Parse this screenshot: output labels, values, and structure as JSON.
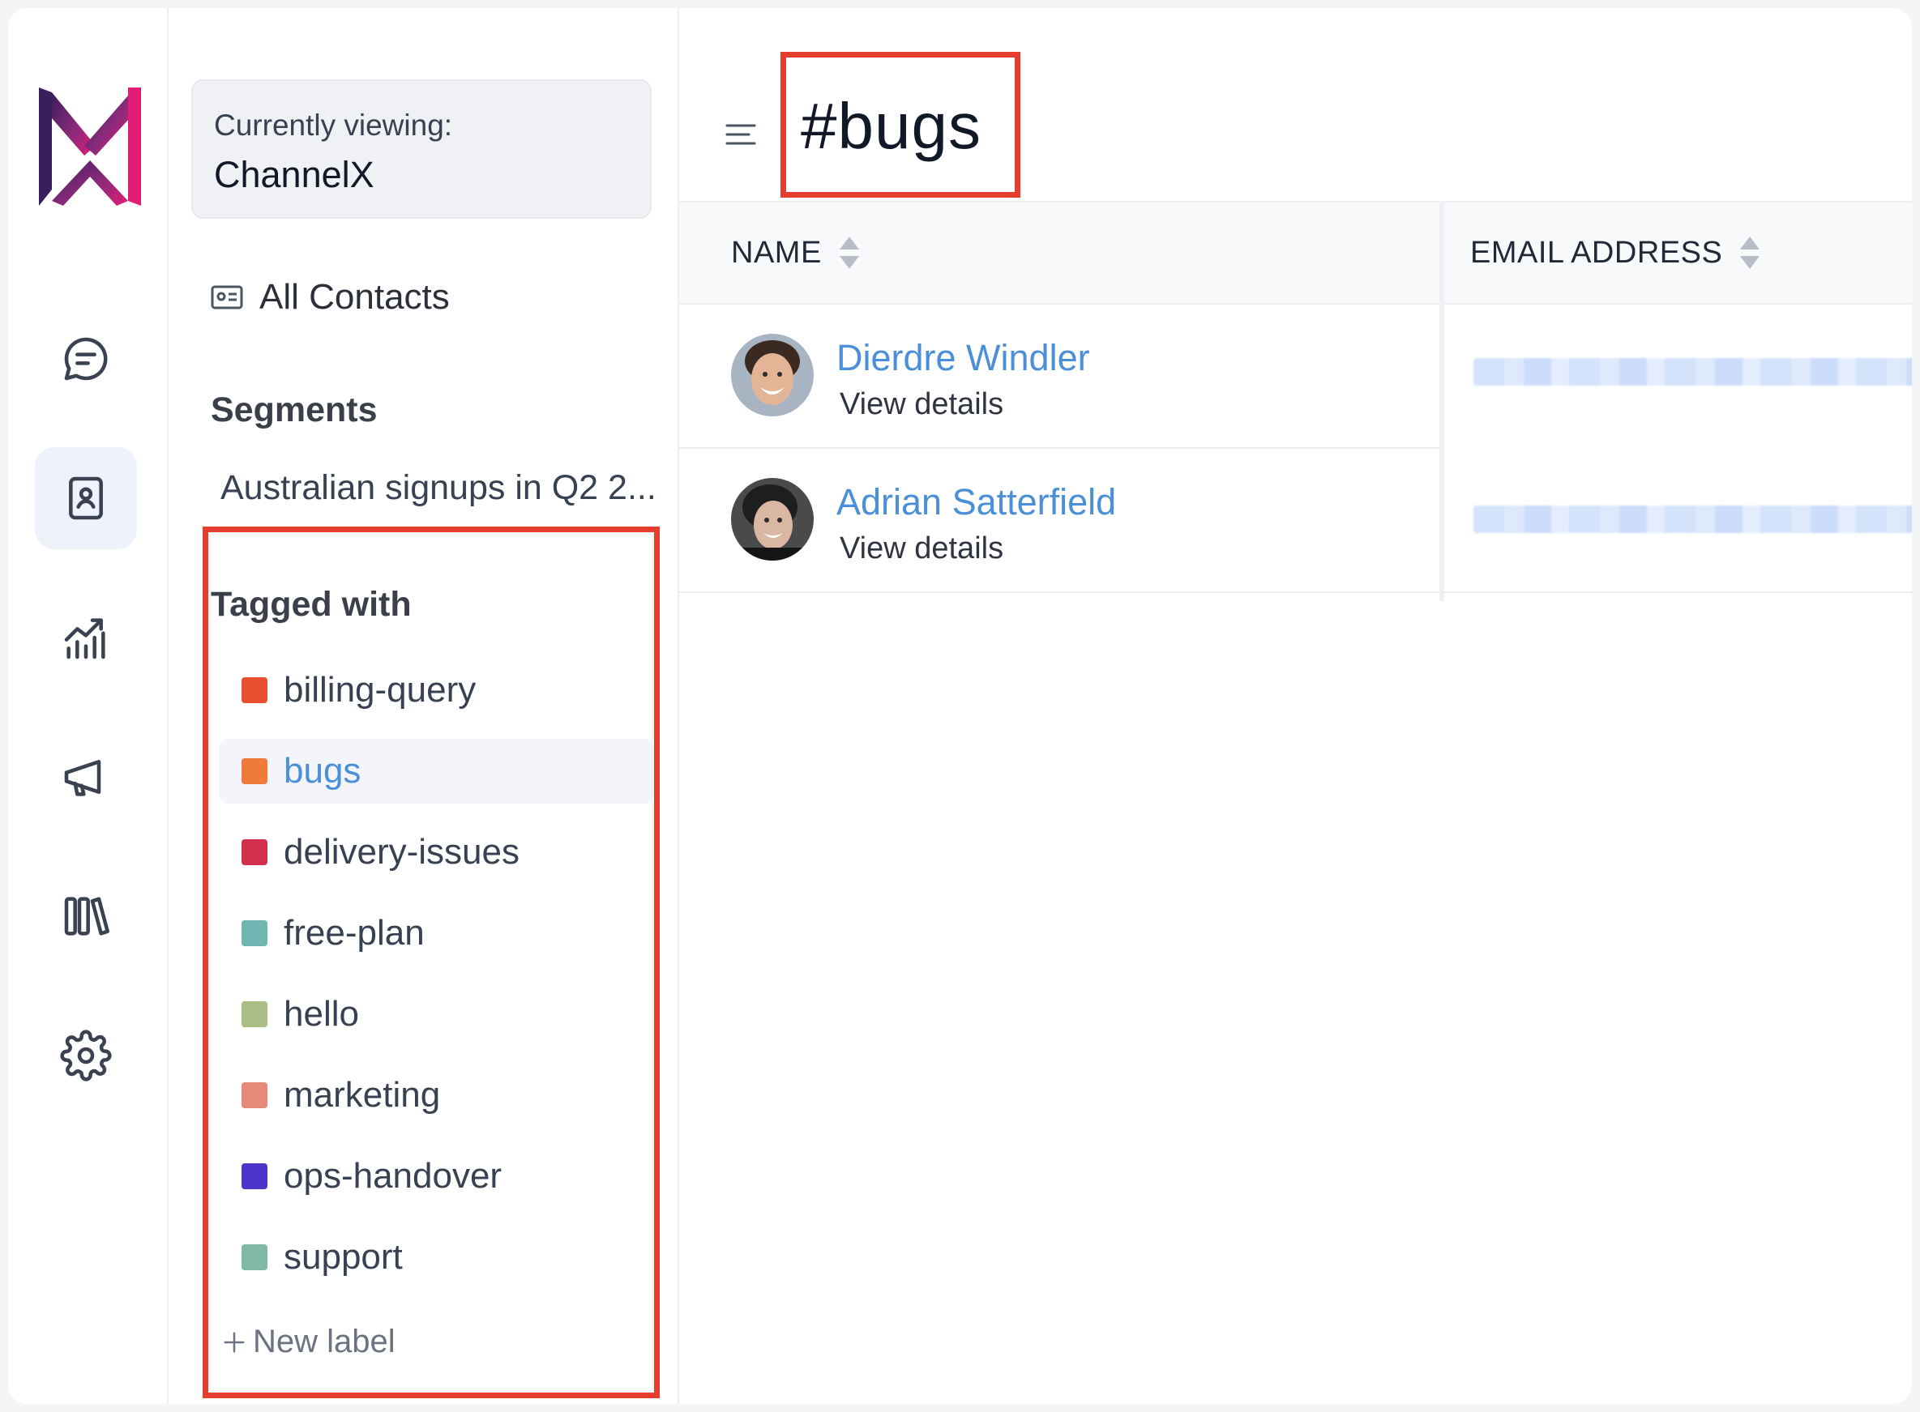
{
  "sidebar": {
    "viewing_label": "Currently viewing:",
    "viewing_value": "ChannelX",
    "all_contacts": "All Contacts",
    "segments_title": "Segments",
    "segments": [
      "Australian signups in Q2 2..."
    ],
    "tagged_title": "Tagged with",
    "tags": [
      {
        "label": "billing-query",
        "color": "#e8502f"
      },
      {
        "label": "bugs",
        "color": "#f07a3a",
        "active": true
      },
      {
        "label": "delivery-issues",
        "color": "#d0304c"
      },
      {
        "label": "free-plan",
        "color": "#6fb6b3"
      },
      {
        "label": "hello",
        "color": "#a9bd85"
      },
      {
        "label": "marketing",
        "color": "#e58a78"
      },
      {
        "label": "ops-handover",
        "color": "#4c35c8"
      },
      {
        "label": "support",
        "color": "#7fb8a6"
      }
    ],
    "new_label": "New label"
  },
  "main": {
    "title": "#bugs",
    "columns": [
      "NAME",
      "EMAIL ADDRESS"
    ],
    "rows": [
      {
        "name": "Dierdre Windler",
        "link": "View details"
      },
      {
        "name": "Adrian Satterfield",
        "link": "View details"
      }
    ]
  },
  "colors": {
    "accent": "#4a8fd8",
    "highlight_box": "#e53d2e"
  }
}
